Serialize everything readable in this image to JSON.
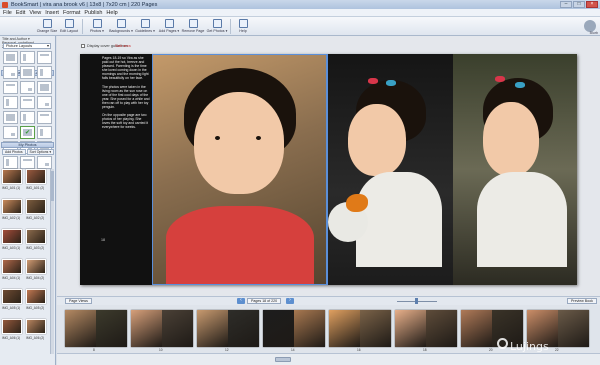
{
  "window": {
    "title": "BookSmart | vira ana brook v6 | 13x8 | 7x20 cm | 220 Pages",
    "controls": [
      "–",
      "□",
      "×"
    ]
  },
  "menu": [
    "File",
    "Edit",
    "View",
    "Insert",
    "Format",
    "Publish",
    "Help"
  ],
  "toolbar": {
    "buttons": [
      {
        "label": "Change Size",
        "icon": "resize-icon"
      },
      {
        "label": "Edit Layout",
        "icon": "layout-icon"
      },
      {
        "label": "Photos ▾",
        "icon": "photos-icon"
      },
      {
        "label": "Backgrounds ▾",
        "icon": "background-icon"
      },
      {
        "label": "Guidelines ▾",
        "icon": "guides-icon"
      },
      {
        "label": "Add Pages ▾",
        "icon": "add-page-icon"
      },
      {
        "label": "Remove Page",
        "icon": "remove-page-icon"
      },
      {
        "label": "Get Photos ▾",
        "icon": "get-photos-icon"
      },
      {
        "label": "Help",
        "icon": "help-icon"
      }
    ],
    "brand_label": "Blurb"
  },
  "sidebar": {
    "info": [
      "Title and Author ▾",
      "Personal, undefined",
      "220 pages"
    ],
    "layouts_header": "Choose Page Layout",
    "layouts_dropdown": "Picture Layouts",
    "layouts": [
      0,
      1,
      2,
      3,
      4,
      5,
      6,
      7,
      8,
      9,
      10,
      11,
      12,
      13,
      14,
      15,
      16,
      17,
      18,
      19,
      20,
      21,
      22,
      23,
      24
    ],
    "selected_layout": 16,
    "photos_header": "My Photos",
    "photo_tabs": [
      "Add Photos",
      "Sort Options ▾"
    ],
    "photos": [
      {
        "caption": "IMG_A01 (1)",
        "color": "#b7774f"
      },
      {
        "caption": "IMG_A01 (2)",
        "color": "#9a5a3f"
      },
      {
        "caption": "IMG_A02 (1)",
        "color": "#c98a5c"
      },
      {
        "caption": "IMG_A02 (2)",
        "color": "#7c5c3e"
      },
      {
        "caption": "IMG_A03 (1)",
        "color": "#a44c3a"
      },
      {
        "caption": "IMG_A03 (2)",
        "color": "#8b6a4c"
      },
      {
        "caption": "IMG_A04 (1)",
        "color": "#b0684a"
      },
      {
        "caption": "IMG_A04 (2)",
        "color": "#d19c74"
      },
      {
        "caption": "IMG_A05 (1)",
        "color": "#6e4a32"
      },
      {
        "caption": "IMG_A05 (2)",
        "color": "#c27852"
      },
      {
        "caption": "IMG_A06 (1)",
        "color": "#94583c"
      },
      {
        "caption": "IMG_A06 (2)",
        "color": "#b98560"
      }
    ]
  },
  "workspace": {
    "checkbox_label": "Display cover guidelines",
    "red_note": "Safe area",
    "text_paragraphs": [
      "Pages 18-19 so Vira as she paid out the hot, breeze and pleased. Parenting is the time she loved coming down in the mornings and the morning light falls beautifully on her face.",
      "The photos were taken in the living room as the sun rose on one of the first cool days of the year. She posed for a while and then ran off to play with her toy penguin.",
      "On the opposite page are two photos of her playing. She loves the soft toy and carried it everywhere for weeks."
    ],
    "left_page_number": "18"
  },
  "nav": {
    "left_btn": "Page Views",
    "center_label": "Pages 18 of 220",
    "right_btn": "Preview Book"
  },
  "strip": {
    "pages": [
      {
        "num": "8",
        "colors": [
          "#b58a63",
          "#3c3a2c"
        ]
      },
      {
        "num": "10",
        "colors": [
          "#d7a07a",
          "#4a4036"
        ]
      },
      {
        "num": "12",
        "colors": [
          "#c89a6f",
          "#2e2d29"
        ]
      },
      {
        "num": "14",
        "colors": [
          "#1d1d1d",
          "#a87850"
        ]
      },
      {
        "num": "16",
        "colors": [
          "#e0a060",
          "#7a6248"
        ]
      },
      {
        "num": "18",
        "colors": [
          "#e8b08a",
          "#5e4c3a"
        ]
      },
      {
        "num": "20",
        "colors": [
          "#b07a58",
          "#3a3328"
        ]
      },
      {
        "num": "22",
        "colors": [
          "#cc8e68",
          "#6a5a48"
        ]
      }
    ]
  },
  "watermark": "Lujings"
}
